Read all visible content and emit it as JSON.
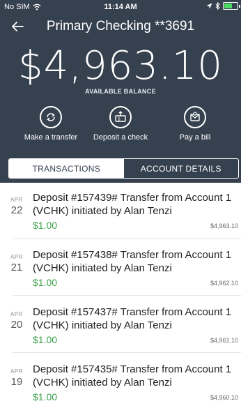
{
  "status_bar": {
    "carrier": "No SIM",
    "time": "11:14 AM"
  },
  "header": {
    "title": "Primary Checking **3691",
    "balance": "$4,963.10",
    "balance_label": "AVAILABLE BALANCE"
  },
  "actions": [
    {
      "label": "Make a transfer",
      "icon": "transfer-icon"
    },
    {
      "label": "Deposit a check",
      "icon": "deposit-check-icon"
    },
    {
      "label": "Pay a bill",
      "icon": "pay-bill-icon"
    }
  ],
  "tabs": [
    {
      "label": "TRANSACTIONS",
      "active": true
    },
    {
      "label": "ACCOUNT DETAILS",
      "active": false
    }
  ],
  "transactions": [
    {
      "month": "APR",
      "day": "22",
      "description": "Deposit #157439# Transfer from Account 1 (VCHK) initiated by Alan Tenzi",
      "amount": "$1.00",
      "running_balance": "$4,963.10"
    },
    {
      "month": "APR",
      "day": "21",
      "description": "Deposit #157438# Transfer from Account 1 (VCHK) initiated by Alan Tenzi",
      "amount": "$1.00",
      "running_balance": "$4,962.10"
    },
    {
      "month": "APR",
      "day": "20",
      "description": "Deposit #157437# Transfer from Account 1 (VCHK) initiated by Alan Tenzi",
      "amount": "$1.00",
      "running_balance": "$4,961.10"
    },
    {
      "month": "APR",
      "day": "19",
      "description": "Deposit #157435# Transfer from Account 1 (VCHK) initiated by Alan Tenzi",
      "amount": "$1.00",
      "running_balance": "$4,960.10"
    }
  ],
  "colors": {
    "header_bg": "#36414f",
    "amount_green": "#3aa04a",
    "battery_green": "#4cd964"
  }
}
